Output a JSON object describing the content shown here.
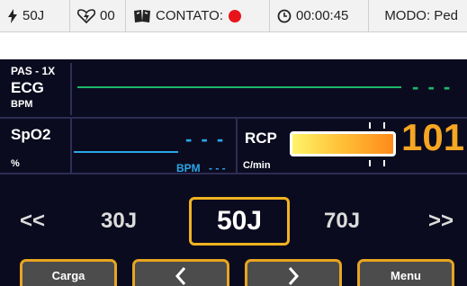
{
  "status_bar": {
    "energy": "50J",
    "shocks": "00",
    "contact_label": "CONTATO:",
    "contact_status_color": "#e8141b",
    "timer": "00:00:45",
    "mode": "MODO: Ped"
  },
  "ecg": {
    "lead_label": "PAS - 1X",
    "label": "ECG",
    "unit": "BPM",
    "value": "- - -",
    "trace_color": "#1fb86a"
  },
  "spo2": {
    "label": "SpO2",
    "unit": "%",
    "value": "- - -",
    "pulse_unit": "BPM",
    "pulse_value": "- - -",
    "trace_color": "#2aa7e8"
  },
  "rcp": {
    "label": "RCP",
    "unit": "C/min",
    "value": "101",
    "value_color": "#f5a623"
  },
  "energy_selector": {
    "prev": "<<",
    "left_option": "30J",
    "selected": "50J",
    "right_option": "70J",
    "next": ">>",
    "highlight_color": "#f2b321"
  },
  "softkeys": {
    "charge": "Carga",
    "left": "left-arrow-icon",
    "right": "right-arrow-icon",
    "menu": "Menu",
    "border_color": "#e7a520"
  },
  "icons": {
    "energy": "lightning-bolt-icon",
    "shock_count": "shock-heart-icon",
    "contact": "pads-icon",
    "timer": "clock-icon"
  }
}
